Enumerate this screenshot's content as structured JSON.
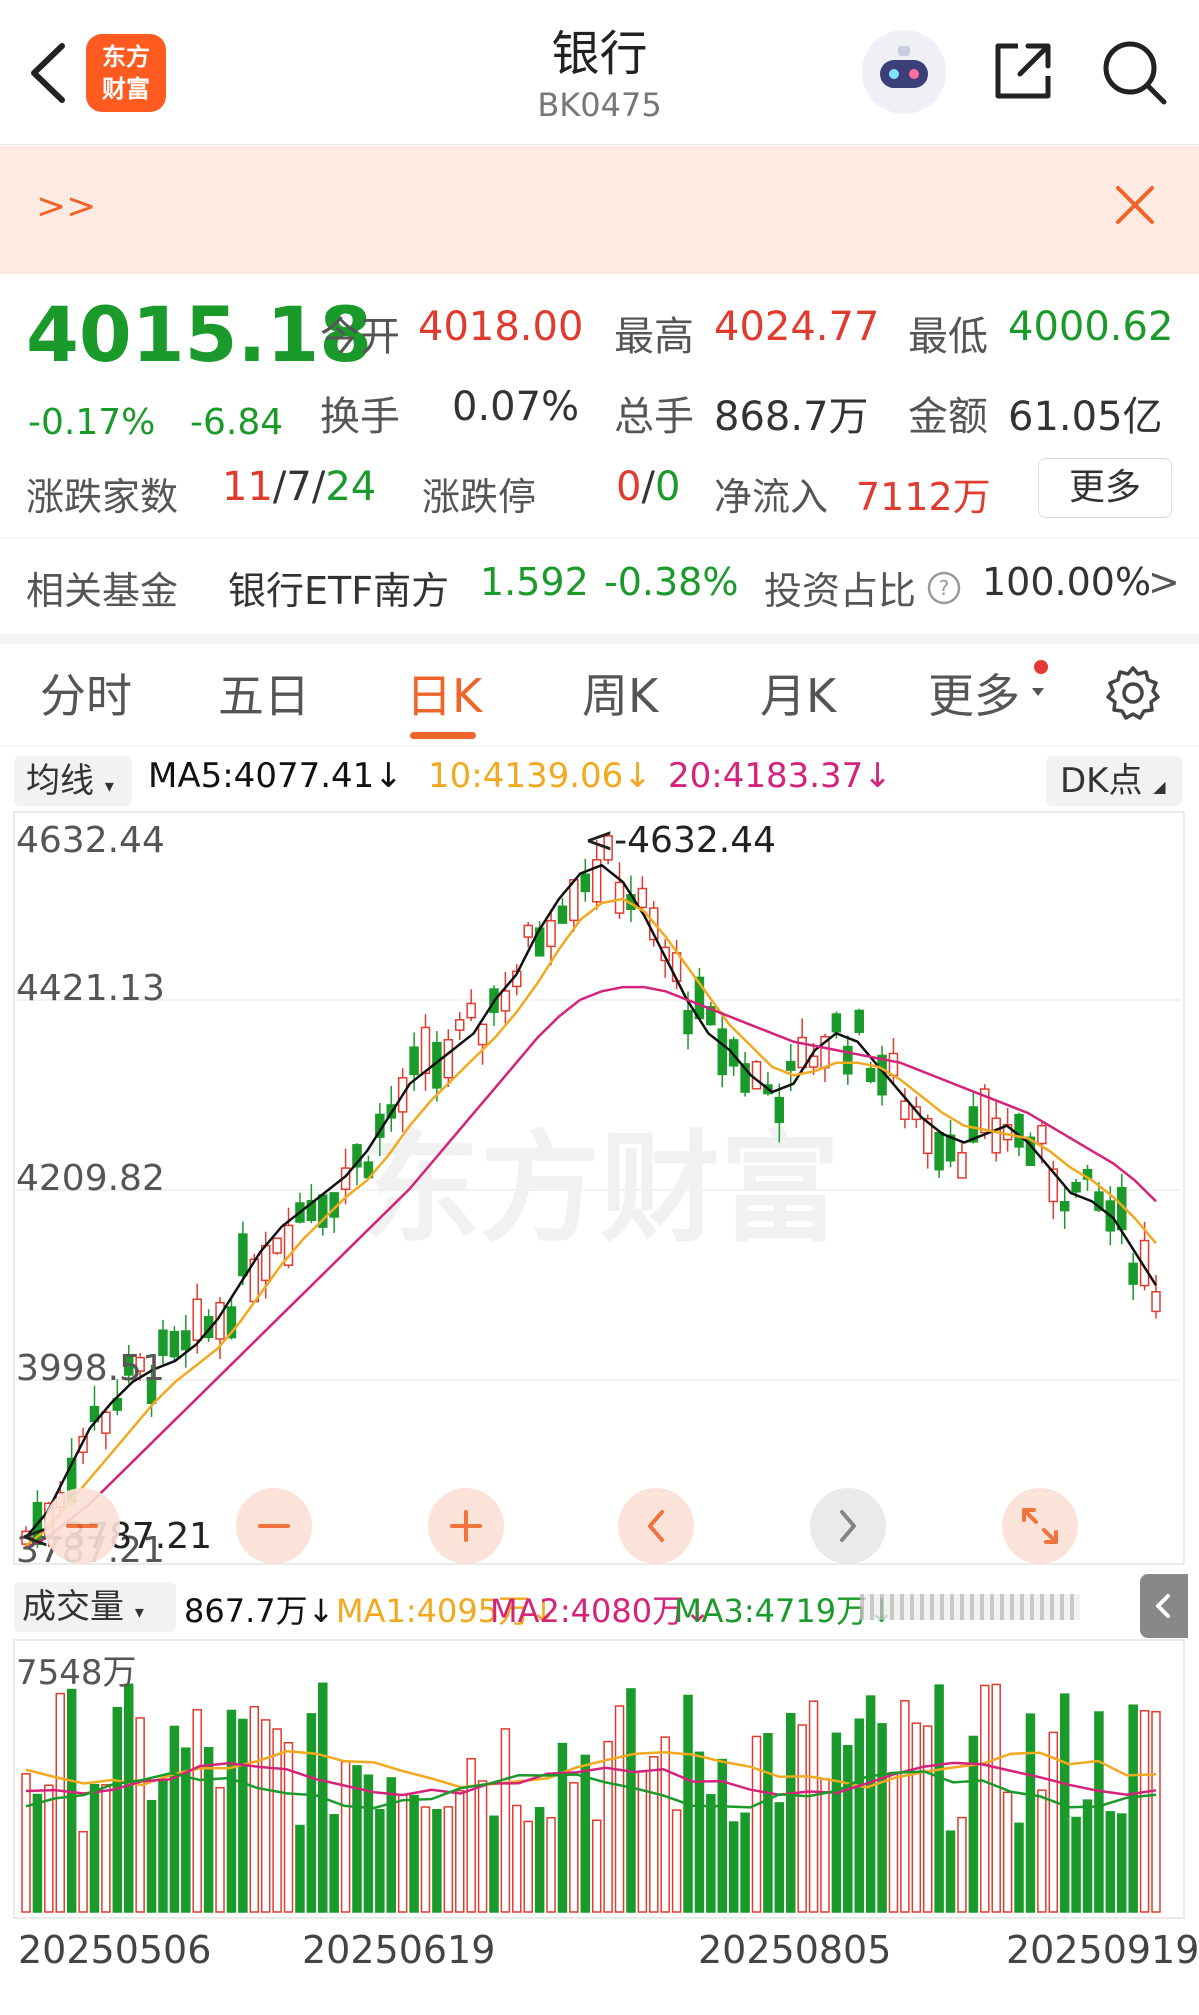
{
  "header": {
    "title": "银行",
    "code": "BK0475",
    "logo_text_1": "东方",
    "logo_text_2": "财富"
  },
  "banner": {
    "more": ">>"
  },
  "quote": {
    "price": "4015.18",
    "change_pct": "-0.17%",
    "change": "-6.84",
    "open_label": "今开",
    "open": "4018.00",
    "high_label": "最高",
    "high": "4024.77",
    "low_label": "最低",
    "low": "4000.62",
    "turnover_label": "换手",
    "turnover": "0.07%",
    "volume_label": "总手",
    "volume": "868.7万",
    "amount_label": "金额",
    "amount": "61.05亿",
    "breadth_label": "涨跌家数",
    "breadth_up": "11",
    "breadth_sep1": "/",
    "breadth_flat": "7",
    "breadth_sep2": "/",
    "breadth_down": "24",
    "limit_label": "涨跌停",
    "limit_up": "0",
    "limit_sep": "/",
    "limit_down": "0",
    "netflow_label": "净流入",
    "netflow": "7112万",
    "more_button": "更多"
  },
  "fund": {
    "label": "相关基金",
    "name": "银行ETF南方",
    "price": "1.592",
    "change": "-0.38%",
    "ratio_label": "投资占比",
    "ratio": "100.00%",
    "arrow": ">"
  },
  "tabs": [
    {
      "label": "分时"
    },
    {
      "label": "五日"
    },
    {
      "label": "日K"
    },
    {
      "label": "周K"
    },
    {
      "label": "月K"
    },
    {
      "label": "更多"
    }
  ],
  "ma_legend": {
    "select": "均线",
    "ma5": "MA5:4077.41↓",
    "ma10": "10:4139.06↓",
    "ma20": "20:4183.37↓",
    "dk": "DK点"
  },
  "vol_legend": {
    "select": "成交量",
    "vol": "867.7万↓",
    "ma1": "MA1:4095万↓",
    "ma2": "MA2:4080万↓",
    "ma3": "MA3:4719万↓"
  },
  "colors": {
    "up": "#e13b2f",
    "down": "#1a9a2b",
    "accent": "#f0642a",
    "ma5": "#111111",
    "ma10": "#f2a91f",
    "ma20": "#d4237a"
  },
  "chart_data": {
    "type": "candlestick",
    "y_ticks": [
      "4632.44",
      "4421.13",
      "4209.82",
      "3998.51",
      "3787.21"
    ],
    "max_marker": "<-4632.44",
    "min_marker": "<-3787.21",
    "watermark": "东方财富",
    "volume_max_label": "7548万",
    "x_labels": [
      "20250506",
      "20250619",
      "20250805",
      "20250919"
    ],
    "ylim": [
      3787.21,
      4632.44
    ],
    "ma_series": [
      {
        "name": "MA5",
        "color": "#111111",
        "values": [
          3800,
          3830,
          3880,
          3930,
          3960,
          3985,
          4000,
          4010,
          4030,
          4060,
          4100,
          4140,
          4170,
          4190,
          4210,
          4230,
          4260,
          4300,
          4340,
          4360,
          4380,
          4400,
          4440,
          4470,
          4520,
          4560,
          4590,
          4600,
          4580,
          4540,
          4490,
          4440,
          4400,
          4380,
          4350,
          4330,
          4340,
          4380,
          4400,
          4390,
          4360,
          4330,
          4300,
          4280,
          4270,
          4280,
          4290,
          4270,
          4240,
          4210,
          4200,
          4180,
          4140,
          4100
        ]
      },
      {
        "name": "MA10",
        "color": "#f2a91f",
        "values": [
          3790,
          3810,
          3840,
          3870,
          3900,
          3930,
          3960,
          3985,
          4005,
          4025,
          4055,
          4090,
          4125,
          4155,
          4180,
          4205,
          4225,
          4255,
          4290,
          4320,
          4345,
          4370,
          4395,
          4425,
          4460,
          4500,
          4535,
          4555,
          4560,
          4545,
          4515,
          4480,
          4445,
          4410,
          4385,
          4360,
          4350,
          4355,
          4365,
          4365,
          4360,
          4345,
          4325,
          4305,
          4290,
          4285,
          4280,
          4275,
          4260,
          4240,
          4225,
          4205,
          4180,
          4150
        ]
      },
      {
        "name": "MA20",
        "color": "#d4237a",
        "values": [
          3787,
          3800,
          3820,
          3840,
          3865,
          3890,
          3915,
          3940,
          3965,
          3990,
          4015,
          4040,
          4065,
          4090,
          4115,
          4140,
          4165,
          4190,
          4215,
          4245,
          4275,
          4305,
          4335,
          4365,
          4395,
          4420,
          4440,
          4450,
          4455,
          4455,
          4450,
          4440,
          4430,
          4420,
          4410,
          4400,
          4390,
          4385,
          4380,
          4375,
          4370,
          4365,
          4355,
          4345,
          4335,
          4325,
          4315,
          4305,
          4290,
          4275,
          4260,
          4245,
          4225,
          4200
        ]
      }
    ]
  }
}
